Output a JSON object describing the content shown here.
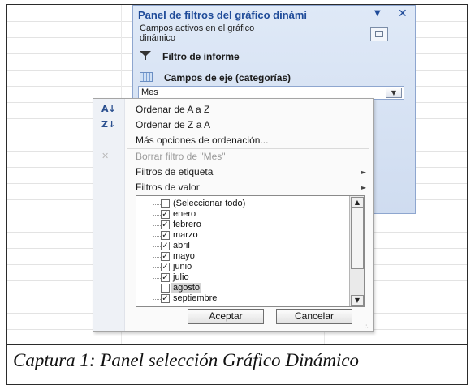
{
  "pane": {
    "title": "Panel de filtros del gráfico dinámi",
    "title_arrow_icon": "dropdown-arrow",
    "close_icon": "close",
    "active_fields_line1": "Campos activos en el gráfico",
    "active_fields_line2": "dinámico",
    "report_filter_label": "Filtro de informe",
    "axis_fields_label": "Campos de eje (categorías)"
  },
  "field": {
    "value": "Mes"
  },
  "menu": {
    "sort_asc": "Ordenar de A a Z",
    "sort_desc": "Ordenar de Z a A",
    "more_sort": "Más opciones de ordenación...",
    "clear_filter": "Borrar filtro de \"Mes\"",
    "label_filters": "Filtros de etiqueta",
    "value_filters": "Filtros de valor",
    "items": [
      {
        "label": "(Seleccionar todo)",
        "checked": false
      },
      {
        "label": "enero",
        "checked": true
      },
      {
        "label": "febrero",
        "checked": true
      },
      {
        "label": "marzo",
        "checked": true
      },
      {
        "label": "abril",
        "checked": true
      },
      {
        "label": "mayo",
        "checked": true
      },
      {
        "label": "junio",
        "checked": true
      },
      {
        "label": "julio",
        "checked": true
      },
      {
        "label": "agosto",
        "checked": false,
        "selected": true
      },
      {
        "label": "septiembre",
        "checked": true
      }
    ],
    "ok": "Aceptar",
    "cancel": "Cancelar"
  },
  "caption": "Captura 1: Panel selección Gráfico Dinámico"
}
